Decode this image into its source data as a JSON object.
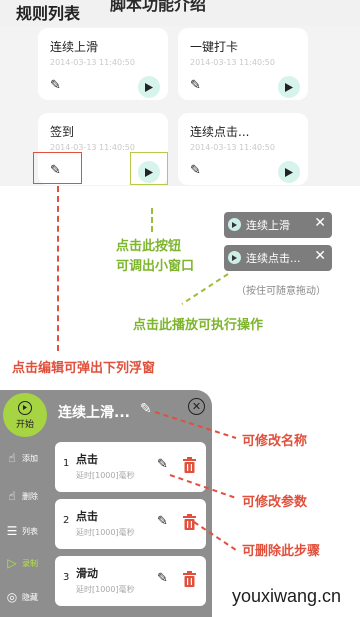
{
  "header": {
    "cut_title": "脚本功能介绍",
    "section_title": "规则列表"
  },
  "rules": [
    {
      "name": "连续上滑",
      "time": "2014-03-13  11:40:50"
    },
    {
      "name": "一键打卡",
      "time": "2014-03-13  11:40:50"
    },
    {
      "name": "签到",
      "time": "2014-03-13  11:40:50"
    },
    {
      "name": "连续点击...",
      "time": "2014-03-13  11:40:50"
    }
  ],
  "mini_windows": [
    {
      "label": "连续上滑"
    },
    {
      "label": "连续点击..."
    }
  ],
  "annotations": {
    "click_button": "点击此按钮",
    "open_mini": "可调出小窗口",
    "drag_hint": "（按住可随意拖动）",
    "play_exec": "点击此播放可执行操作",
    "edit_popup": "点击编辑可弹出下列浮窗",
    "rename": "可修改名称",
    "edit_params": "可修改参数",
    "delete_step": "可删除此步骤"
  },
  "panel": {
    "start_label": "开始",
    "title": "连续上滑...",
    "sidebar": [
      {
        "icon": "hand-add-icon",
        "glyph": "☝",
        "label": "添加"
      },
      {
        "icon": "hand-delete-icon",
        "glyph": "☝",
        "label": "删除"
      },
      {
        "icon": "list-icon",
        "glyph": "☰",
        "label": "列表"
      },
      {
        "icon": "record-icon",
        "glyph": "▷",
        "label": "录制"
      },
      {
        "icon": "eye-hide-icon",
        "glyph": "◎",
        "label": "隐藏"
      }
    ],
    "steps": [
      {
        "num": "1",
        "name": "点击",
        "delay": "延时[1000]毫秒"
      },
      {
        "num": "2",
        "name": "点击",
        "delay": "延时[1000]毫秒"
      },
      {
        "num": "3",
        "name": "滑动",
        "delay": "延时[1000]毫秒"
      }
    ]
  },
  "watermark": "youxiwang.cn",
  "colors": {
    "accent_green": "#a6d443",
    "annotation_red": "#e0503c",
    "annotation_green": "#7db52c",
    "panel_gray": "#8e8e8e",
    "play_bg": "#d6f3ec"
  }
}
